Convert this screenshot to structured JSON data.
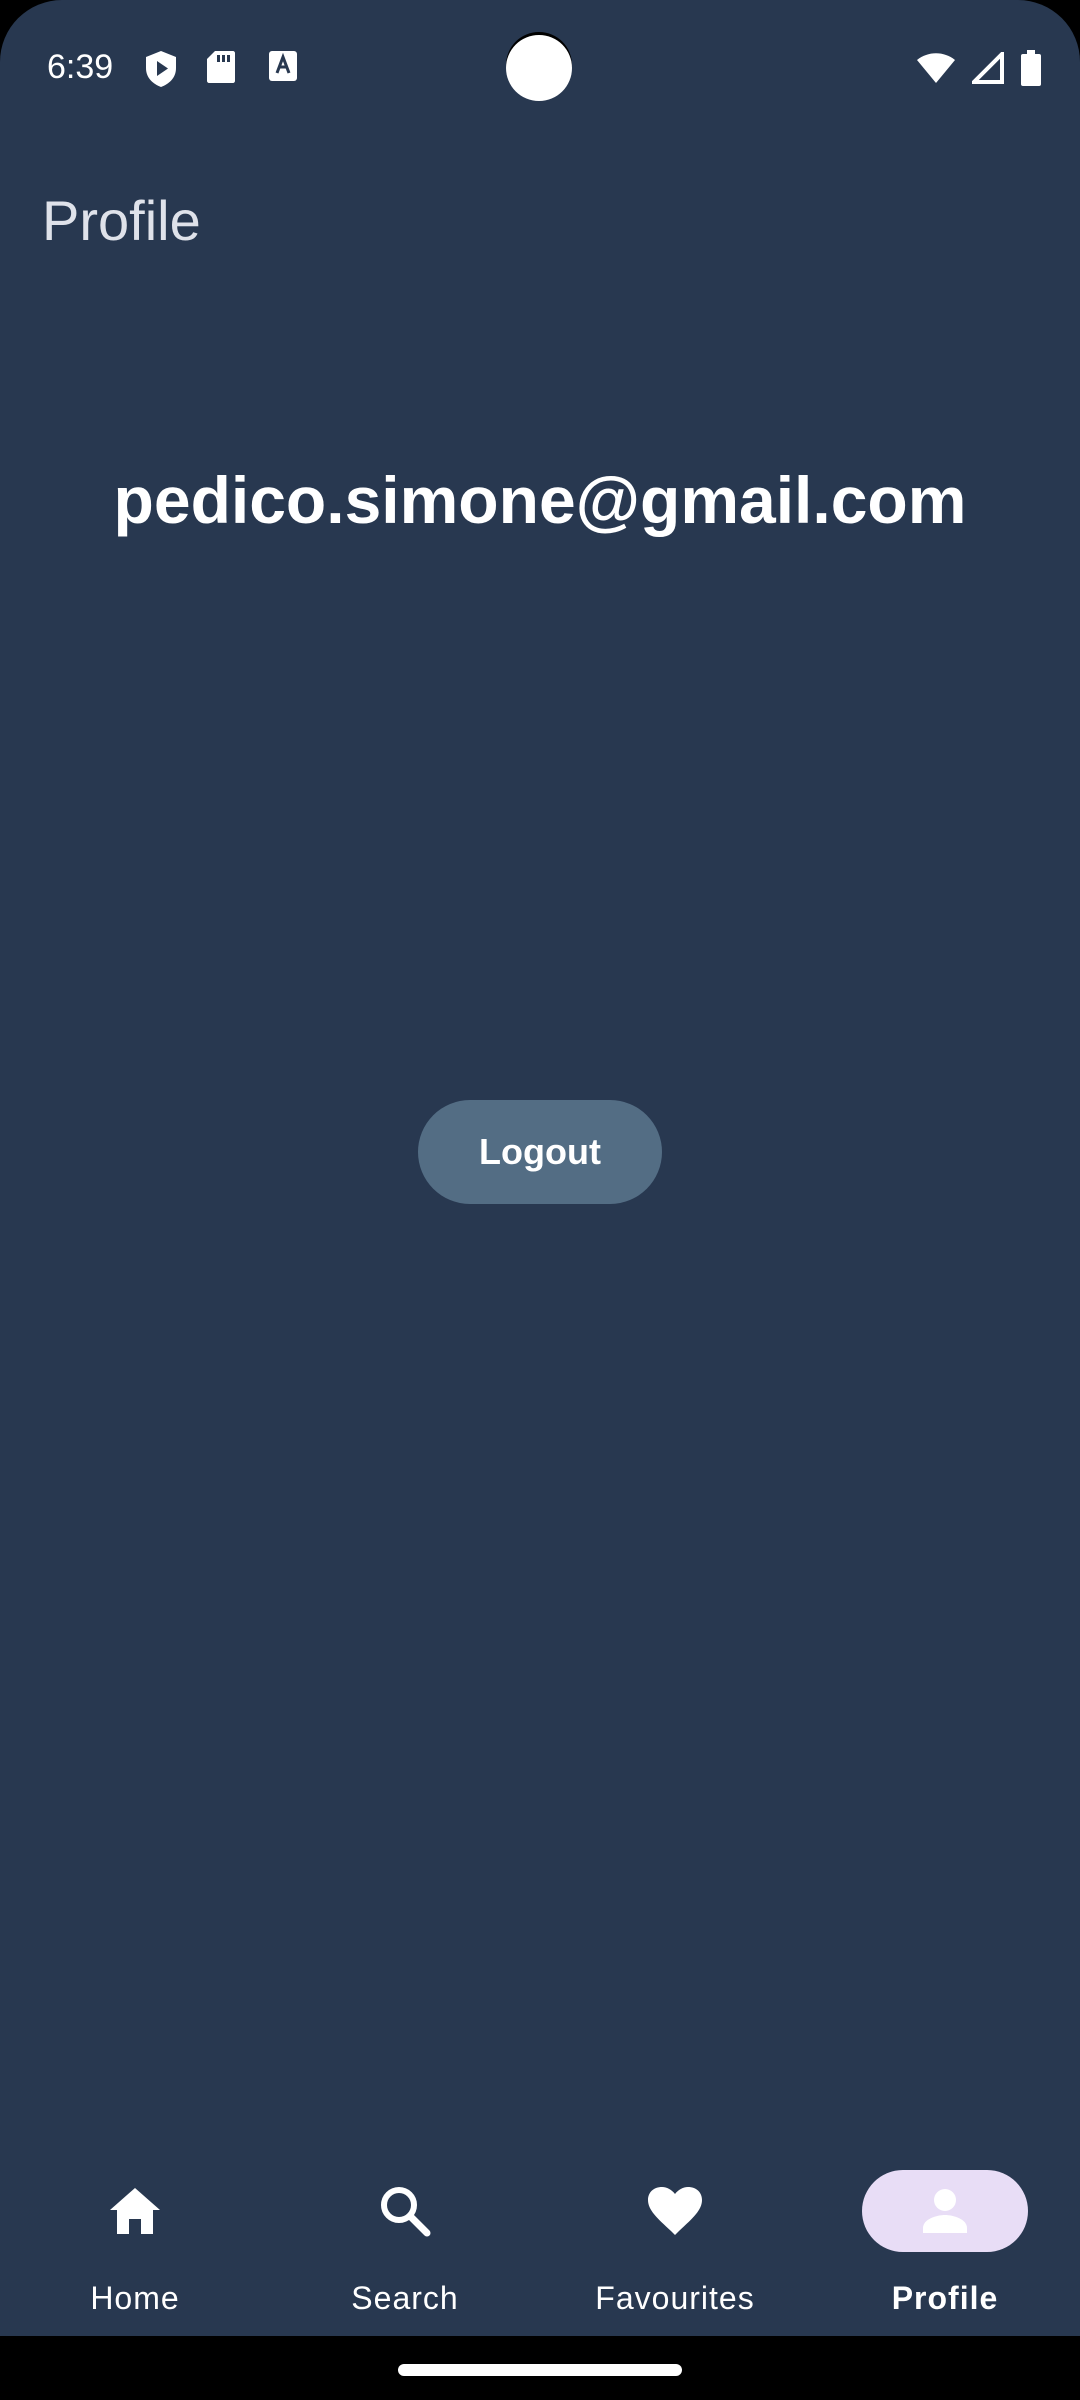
{
  "status_bar": {
    "time": "6:39",
    "icons_left": [
      "shield-play-icon",
      "sd-card-icon",
      "keyboard-a-icon"
    ],
    "icons_right": [
      "wifi-icon",
      "signal-icon",
      "battery-icon"
    ]
  },
  "header": {
    "title": "Profile"
  },
  "profile": {
    "email": "pedico.simone@gmail.com",
    "logout_label": "Logout"
  },
  "bottom_nav": {
    "items": [
      {
        "label": "Home",
        "icon": "home-icon"
      },
      {
        "label": "Search",
        "icon": "search-icon"
      },
      {
        "label": "Favourites",
        "icon": "heart-icon"
      },
      {
        "label": "Profile",
        "icon": "person-icon"
      }
    ],
    "active_index": 3
  },
  "colors": {
    "background": "#283850",
    "button": "#536d84",
    "active_indicator": "#e8ddf6"
  }
}
